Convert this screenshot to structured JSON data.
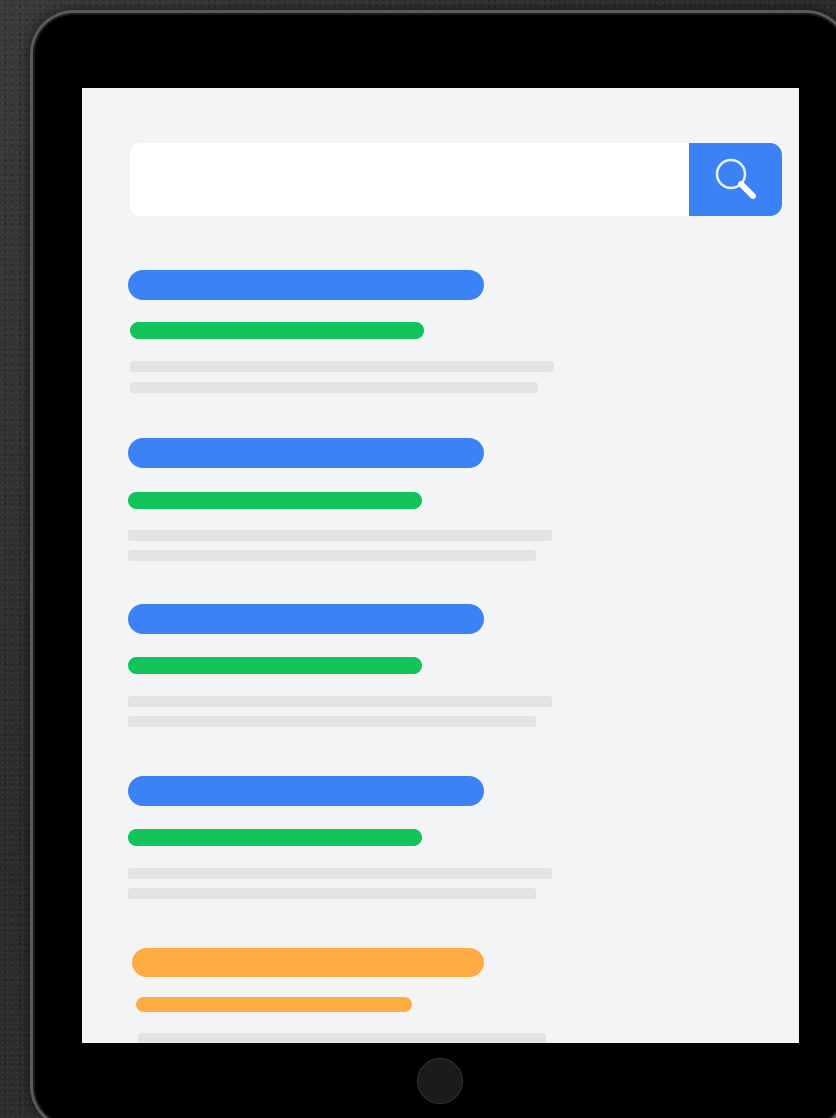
{
  "search": {
    "placeholder": "",
    "value": "",
    "button_icon": "search-icon"
  },
  "colors": {
    "accent_blue": "#3b82f6",
    "green": "#10c35a",
    "orange": "#ffad42",
    "placeholder_gray": "#e3e3e3",
    "screen_bg": "#f3f4f6"
  },
  "results": [
    {
      "style": "standard"
    },
    {
      "style": "standard"
    },
    {
      "style": "standard"
    },
    {
      "style": "standard"
    },
    {
      "style": "ad"
    }
  ]
}
